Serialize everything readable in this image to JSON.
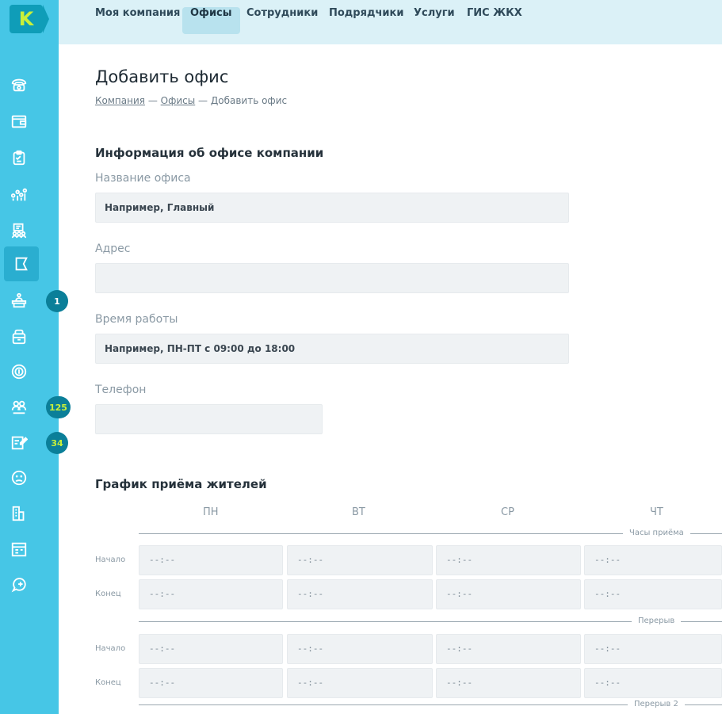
{
  "logo": {
    "letter": "K"
  },
  "nav": {
    "tabs": [
      {
        "label": "Моя компания",
        "active": false
      },
      {
        "label": "Офисы",
        "active": true
      },
      {
        "label": "Сотрудники",
        "active": false
      },
      {
        "label": "Подрядчики",
        "active": false
      },
      {
        "label": "Услуги",
        "active": false
      },
      {
        "label": "ГИС ЖКХ",
        "active": false
      }
    ]
  },
  "sidebar": {
    "icons": [
      "phone-icon",
      "wallet-icon",
      "clipboard-icon",
      "analytics-icon",
      "meeting-icon",
      "company-flag-icon",
      "reception-icon",
      "archive-icon",
      "coin-icon",
      "residents-icon",
      "edit-document-icon",
      "sad-face-icon",
      "buildings-icon",
      "calendar-icon",
      "add-chat-icon"
    ],
    "badges": {
      "reception": "1",
      "residents": "125",
      "documents": "34"
    }
  },
  "page": {
    "title": "Добавить офис",
    "breadcrumb": {
      "company": "Компания",
      "offices": "Офисы",
      "current": "Добавить офис",
      "separator": "—"
    }
  },
  "form": {
    "section_title": "Информация об офисе компании",
    "office_name": {
      "label": "Название офиса",
      "placeholder": "Например, Главный",
      "value": ""
    },
    "address": {
      "label": "Адрес",
      "placeholder": "",
      "value": ""
    },
    "hours": {
      "label": "Время работы",
      "placeholder": "Например, ПН-ПТ с 09:00 до 18:00",
      "value": ""
    },
    "phone": {
      "label": "Телефон",
      "placeholder": "",
      "value": ""
    }
  },
  "schedule": {
    "title": "График приёма жителей",
    "days": [
      "ПН",
      "ВТ",
      "СР",
      "ЧТ"
    ],
    "sections": [
      {
        "label": "Часы приёма"
      },
      {
        "label": "Перерыв"
      },
      {
        "label": "Перерыв 2"
      }
    ],
    "row_labels": {
      "start": "Начало",
      "end": "Конец"
    },
    "time_placeholder": "--:--"
  }
}
